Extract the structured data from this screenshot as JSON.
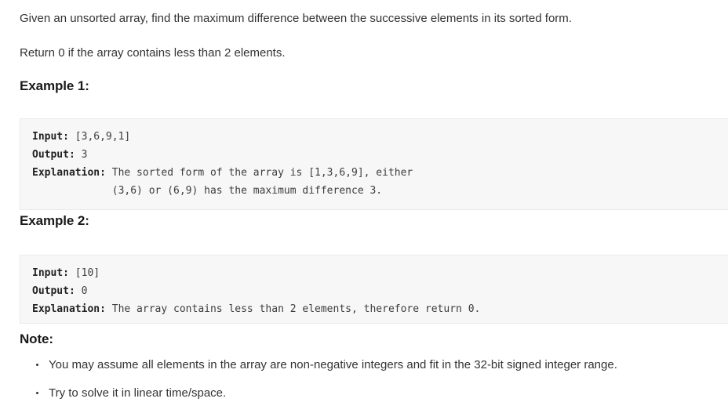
{
  "problem": {
    "intro_lines": [
      "Given an unsorted array, find the maximum difference between the successive elements in its sorted form.",
      "Return 0 if the array contains less than 2 elements."
    ],
    "examples": [
      {
        "heading": "Example 1:",
        "lines": [
          {
            "label": "Input:",
            "value": " [3,6,9,1]"
          },
          {
            "label": "Output:",
            "value": " 3"
          },
          {
            "label": "Explanation:",
            "value": " The sorted form of the array is [1,3,6,9], either"
          },
          {
            "label": "",
            "value": "             (3,6) or (6,9) has the maximum difference 3."
          }
        ]
      },
      {
        "heading": "Example 2:",
        "lines": [
          {
            "label": "Input:",
            "value": " [10]"
          },
          {
            "label": "Output:",
            "value": " 0"
          },
          {
            "label": "Explanation:",
            "value": " The array contains less than 2 elements, therefore return 0."
          }
        ]
      }
    ],
    "note": {
      "heading": "Note:",
      "items": [
        "You may assume all elements in the array are non-negative integers and fit in the 32-bit signed integer range.",
        "Try to solve it in linear time/space."
      ]
    }
  },
  "colors": {
    "text": "#333333",
    "heading": "#1a1a1a",
    "code_background": "#f7f7f7",
    "code_border": "#eaeaea",
    "code_text": "#3d3d3d",
    "page_background": "#ffffff"
  }
}
